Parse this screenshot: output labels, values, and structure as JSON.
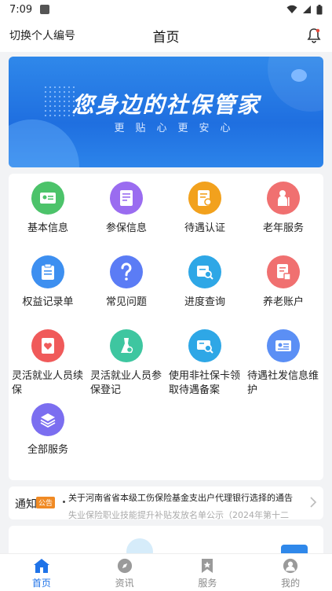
{
  "status": {
    "time": "7:09"
  },
  "header": {
    "left_label": "切换个人编号",
    "title": "首页"
  },
  "banner": {
    "headline": "您身边的社保管家",
    "subline": "更贴心更安心"
  },
  "services": [
    {
      "label": "基本信息",
      "icon": "id-card-icon",
      "color": "#4cc36a"
    },
    {
      "label": "参保信息",
      "icon": "document-insure-icon",
      "color": "#9a6cf0"
    },
    {
      "label": "待遇认证",
      "icon": "certify-icon",
      "color": "#f2a11d"
    },
    {
      "label": "老年服务",
      "icon": "elderly-icon",
      "color": "#f07070"
    },
    {
      "label": "权益记录单",
      "icon": "clipboard-icon",
      "color": "#3d8ff0"
    },
    {
      "label": "常见问题",
      "icon": "question-icon",
      "color": "#5b7cf5"
    },
    {
      "label": "进度查询",
      "icon": "progress-search-icon",
      "color": "#2ea7e6"
    },
    {
      "label": "养老账户",
      "icon": "pension-account-icon",
      "color": "#f07070"
    },
    {
      "label": "灵活就业人员续保",
      "icon": "heart-doc-icon",
      "color": "#f05a5a"
    },
    {
      "label": "灵活就业人员参保登记",
      "icon": "flask-icon",
      "color": "#3ec6a0"
    },
    {
      "label": "使用非社保卡领取待遇备案",
      "icon": "card-search-icon",
      "color": "#2ea7e6"
    },
    {
      "label": "待遇社发信息维护",
      "icon": "info-card-icon",
      "color": "#5b8ff5"
    },
    {
      "label": "全部服务",
      "icon": "layers-icon",
      "color": "#7b6ef0"
    }
  ],
  "notice": {
    "title": "通知",
    "tag": "公告",
    "line1": "关于河南省省本级工伤保险基金支出户代理银行选择的通告",
    "line2": "失业保险职业技能提升补贴发放名单公示（2024年第十二"
  },
  "tabs": [
    {
      "label": "首页",
      "icon": "home-icon"
    },
    {
      "label": "资讯",
      "icon": "compass-icon"
    },
    {
      "label": "服务",
      "icon": "bookmark-icon"
    },
    {
      "label": "我的",
      "icon": "user-icon"
    }
  ],
  "colors": {
    "accent": "#1f73e8",
    "banner_bg": "#2a7fe6",
    "tag": "#f08a24"
  }
}
